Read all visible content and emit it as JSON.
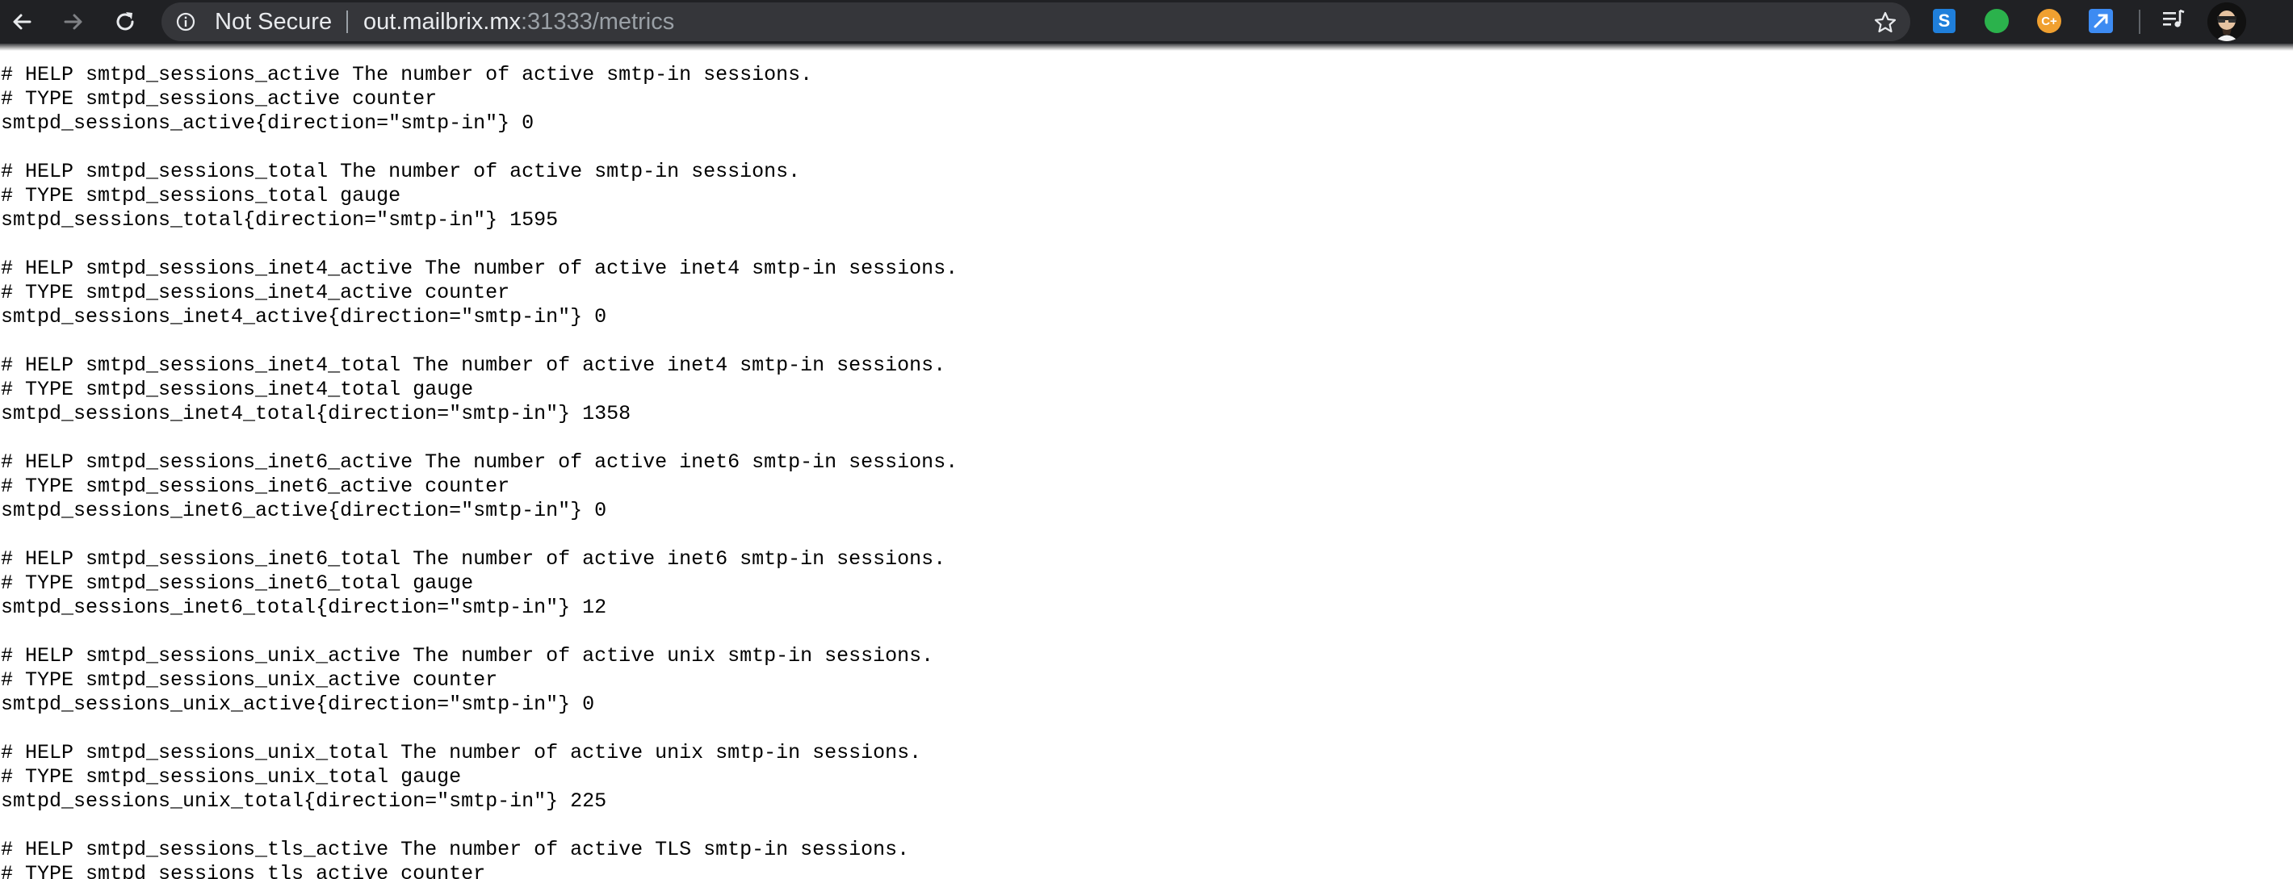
{
  "browser": {
    "security_label": "Not Secure",
    "url_host": "out.mailbrix.mx",
    "url_rest": ":31333/metrics",
    "icons": [
      "back-icon",
      "forward-icon",
      "reload-icon",
      "info-icon",
      "star-icon",
      "music-queue-icon"
    ],
    "extensions": [
      {
        "name": "s-extension-icon",
        "label": "S",
        "color": "#1f7fdb"
      },
      {
        "name": "green-extension-icon",
        "label": "",
        "color": "#2bb24c"
      },
      {
        "name": "c-plus-extension-icon",
        "label": "C+",
        "color": "#f0a030"
      },
      {
        "name": "arrow-extension-icon",
        "label": "",
        "color": "#3d8bf2"
      }
    ],
    "colors": {
      "toolbar_bg": "#202124",
      "omnibox_bg": "#35363a",
      "text_primary": "#e8eaed",
      "text_dim": "#9aa0a6"
    }
  },
  "metrics": {
    "lines": [
      "# HELP smtpd_sessions_active The number of active smtp-in sessions.",
      "# TYPE smtpd_sessions_active counter",
      "smtpd_sessions_active{direction=\"smtp-in\"} 0",
      "",
      "# HELP smtpd_sessions_total The number of active smtp-in sessions.",
      "# TYPE smtpd_sessions_total gauge",
      "smtpd_sessions_total{direction=\"smtp-in\"} 1595",
      "",
      "# HELP smtpd_sessions_inet4_active The number of active inet4 smtp-in sessions.",
      "# TYPE smtpd_sessions_inet4_active counter",
      "smtpd_sessions_inet4_active{direction=\"smtp-in\"} 0",
      "",
      "# HELP smtpd_sessions_inet4_total The number of active inet4 smtp-in sessions.",
      "# TYPE smtpd_sessions_inet4_total gauge",
      "smtpd_sessions_inet4_total{direction=\"smtp-in\"} 1358",
      "",
      "# HELP smtpd_sessions_inet6_active The number of active inet6 smtp-in sessions.",
      "# TYPE smtpd_sessions_inet6_active counter",
      "smtpd_sessions_inet6_active{direction=\"smtp-in\"} 0",
      "",
      "# HELP smtpd_sessions_inet6_total The number of active inet6 smtp-in sessions.",
      "# TYPE smtpd_sessions_inet6_total gauge",
      "smtpd_sessions_inet6_total{direction=\"smtp-in\"} 12",
      "",
      "# HELP smtpd_sessions_unix_active The number of active unix smtp-in sessions.",
      "# TYPE smtpd_sessions_unix_active counter",
      "smtpd_sessions_unix_active{direction=\"smtp-in\"} 0",
      "",
      "# HELP smtpd_sessions_unix_total The number of active unix smtp-in sessions.",
      "# TYPE smtpd_sessions_unix_total gauge",
      "smtpd_sessions_unix_total{direction=\"smtp-in\"} 225",
      "",
      "# HELP smtpd_sessions_tls_active The number of active TLS smtp-in sessions.",
      "# TYPE smtpd_sessions_tls_active counter"
    ]
  }
}
